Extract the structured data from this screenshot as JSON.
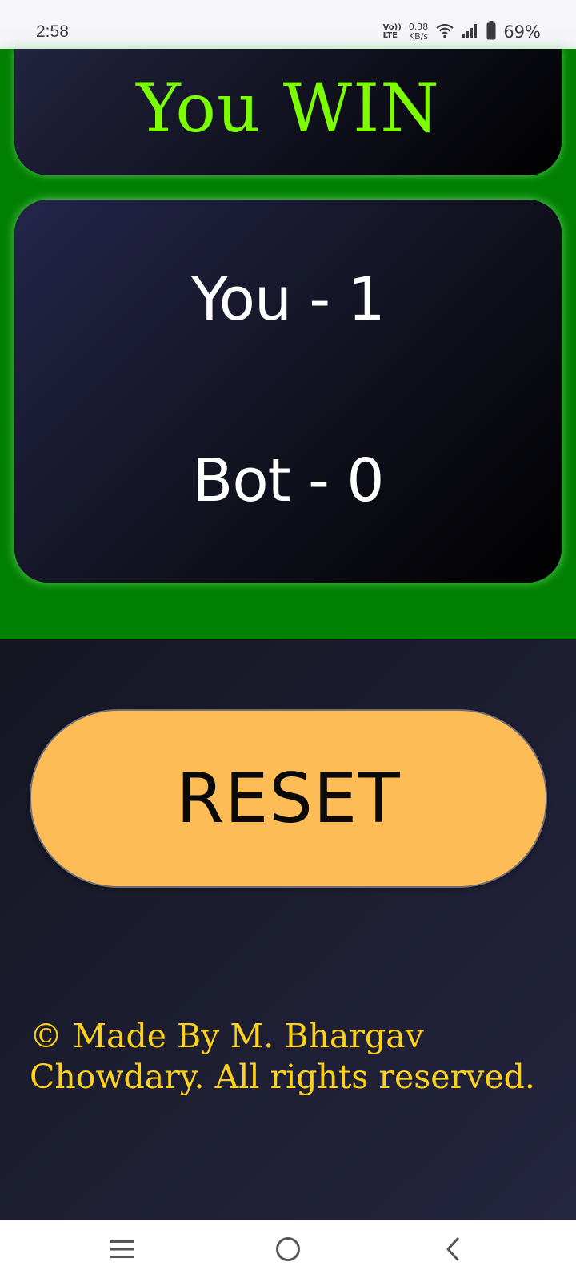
{
  "status_bar": {
    "time": "2:58",
    "volte_top": "Vo))",
    "volte_bottom": "LTE",
    "net_speed_value": "0.38",
    "net_speed_unit": "KB/s",
    "battery": "69%",
    "battery_level": 0.69,
    "icons": [
      "wifi-icon",
      "signal-icon",
      "battery-icon"
    ]
  },
  "game": {
    "result": "You WIN",
    "result_color": "#7cfc00",
    "score_you": "You - 1",
    "score_bot": "Bot - 0",
    "background_color": "#008000"
  },
  "controls": {
    "reset_label": "RESET",
    "reset_color": "#fdbc55"
  },
  "footer": {
    "line1": "© Made By M. Bhargav",
    "line2": "Chowdary. All rights reserved.",
    "color": "#ffd21a"
  },
  "nav_bar": {
    "icons": [
      "recents-icon",
      "home-icon",
      "back-icon"
    ]
  }
}
